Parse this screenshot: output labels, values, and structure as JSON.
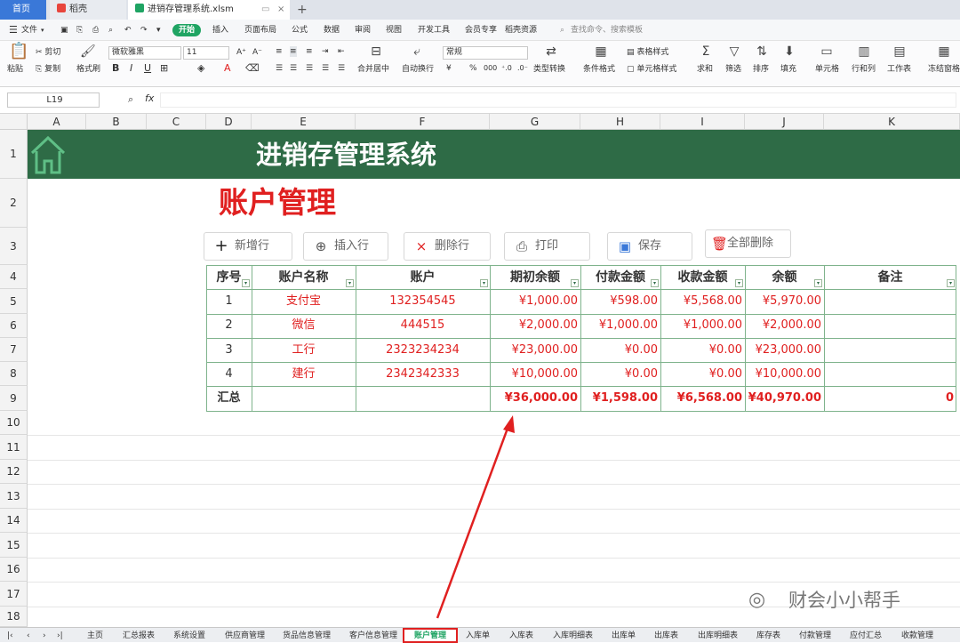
{
  "window_tabs": {
    "home": "首页",
    "app": "稻壳",
    "file": "进销存管理系统.xlsm",
    "new_tab": "+"
  },
  "menu": {
    "file": "文件",
    "start": "开始",
    "items": [
      "插入",
      "页面布局",
      "公式",
      "数据",
      "审阅",
      "视图",
      "开发工具",
      "会员专享",
      "稻壳资源"
    ],
    "search_placeholder": "查找命令、搜索模板"
  },
  "ribbon": {
    "paste": "粘贴",
    "cut": "剪切",
    "copy": "复制",
    "format_painter": "格式刷",
    "font_name": "微软雅黑",
    "font_size": "11",
    "merge": "合并居中",
    "wrap": "自动换行",
    "number_format": "常规",
    "type_convert": "类型转换",
    "cond_format": "条件格式",
    "table_style": "表格样式",
    "cell_style": "单元格样式",
    "sum": "求和",
    "filter": "筛选",
    "sort": "排序",
    "fill": "填充",
    "cell": "单元格",
    "row_col": "行和列",
    "worksheet": "工作表",
    "freeze": "冻结窗格",
    "format_symbols": {
      "currency": "¥",
      "percent": "%",
      "thousands": "000"
    }
  },
  "formula_bar": {
    "cell_ref": "L19",
    "fx": "fx"
  },
  "columns": [
    "A",
    "B",
    "C",
    "D",
    "E",
    "F",
    "G",
    "H",
    "I",
    "J",
    "K"
  ],
  "rows": [
    "1",
    "2",
    "3",
    "4",
    "5",
    "6",
    "7",
    "8",
    "9",
    "10",
    "11",
    "12",
    "13",
    "14",
    "15",
    "16",
    "17",
    "18"
  ],
  "sheet": {
    "banner_title": "进销存管理系统",
    "page_title": "账户管理",
    "buttons": {
      "add": "新增行",
      "insert": "插入行",
      "delete": "删除行",
      "print": "打印",
      "save": "保存",
      "delete_all": "全部删除"
    },
    "table": {
      "headers": [
        "序号",
        "账户名称",
        "账户",
        "期初余额",
        "付款金额",
        "收款金额",
        "余额",
        "备注"
      ],
      "rows": [
        [
          "1",
          "支付宝",
          "132354545",
          "¥1,000.00",
          "¥598.00",
          "¥5,568.00",
          "¥5,970.00",
          ""
        ],
        [
          "2",
          "微信",
          "444515",
          "¥2,000.00",
          "¥1,000.00",
          "¥1,000.00",
          "¥2,000.00",
          ""
        ],
        [
          "3",
          "工行",
          "2323234234",
          "¥23,000.00",
          "¥0.00",
          "¥0.00",
          "¥23,000.00",
          ""
        ],
        [
          "4",
          "建行",
          "2342342333",
          "¥10,000.00",
          "¥0.00",
          "¥0.00",
          "¥10,000.00",
          ""
        ]
      ],
      "total": [
        "汇总",
        "",
        "",
        "¥36,000.00",
        "¥1,598.00",
        "¥6,568.00",
        "¥40,970.00",
        "0"
      ]
    }
  },
  "watermark": "财会小小帮手",
  "sheet_tabs": [
    "主页",
    "汇总报表",
    "系统设置",
    "供应商管理",
    "货品信息管理",
    "客户信息管理",
    "账户管理",
    "入库单",
    "入库表",
    "入库明细表",
    "出库单",
    "出库表",
    "出库明细表",
    "库存表",
    "付款管理",
    "应付汇总",
    "收款管理"
  ],
  "active_sheet": "账户管理",
  "colors": {
    "banner": "#2e6b46",
    "accent_red": "#e02020",
    "table_border": "#7fb38c",
    "active_green": "#1fa463"
  }
}
